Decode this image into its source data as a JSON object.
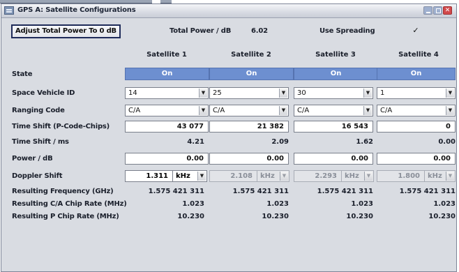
{
  "window": {
    "title": "GPS A: Satellite Configurations",
    "colors": {
      "state_on": "#6d8fd0",
      "title_bar": "#d8dbe3",
      "panel": "#d9dce2",
      "close": "#d2494b"
    }
  },
  "top": {
    "adjust_label": "Adjust Total Power To 0 dB",
    "total_power_label": "Total Power / dB",
    "total_power_value": "6.02",
    "use_spreading_label": "Use Spreading",
    "use_spreading_checked": "✓"
  },
  "rows": {
    "state": "State",
    "svid": "Space Vehicle ID",
    "ranging": "Ranging Code",
    "timeshift_chips": "Time Shift (P-Code-Chips)",
    "timeshift_ms": "Time Shift / ms",
    "power": "Power / dB",
    "doppler": "Doppler Shift",
    "res_freq": "Resulting Frequency (GHz)",
    "res_ca": "Resulting C/A Chip Rate (MHz)",
    "res_p": "Resulting P Chip Rate (MHz)"
  },
  "satellites": [
    {
      "header": "Satellite 1",
      "state": "On",
      "svid": "14",
      "ranging": "C/A",
      "timeshift_chips": "43 077",
      "timeshift_ms": "4.21",
      "power": "0.00",
      "doppler_value": "1.311",
      "doppler_unit": "kHz",
      "res_freq": "1.575 421 311",
      "res_ca": "1.023",
      "res_p": "10.230"
    },
    {
      "header": "Satellite 2",
      "state": "On",
      "svid": "25",
      "ranging": "C/A",
      "timeshift_chips": "21 382",
      "timeshift_ms": "2.09",
      "power": "0.00",
      "doppler_value": "2.108",
      "doppler_unit": "kHz",
      "res_freq": "1.575 421 311",
      "res_ca": "1.023",
      "res_p": "10.230"
    },
    {
      "header": "Satellite 3",
      "state": "On",
      "svid": "30",
      "ranging": "C/A",
      "timeshift_chips": "16 543",
      "timeshift_ms": "1.62",
      "power": "0.00",
      "doppler_value": "2.293",
      "doppler_unit": "kHz",
      "res_freq": "1.575 421 311",
      "res_ca": "1.023",
      "res_p": "10.230"
    },
    {
      "header": "Satellite 4",
      "state": "On",
      "svid": "1",
      "ranging": "C/A",
      "timeshift_chips": "0",
      "timeshift_ms": "0.00",
      "power": "0.00",
      "doppler_value": "1.800",
      "doppler_unit": "kHz",
      "res_freq": "1.575 421 311",
      "res_ca": "1.023",
      "res_p": "10.230"
    }
  ]
}
